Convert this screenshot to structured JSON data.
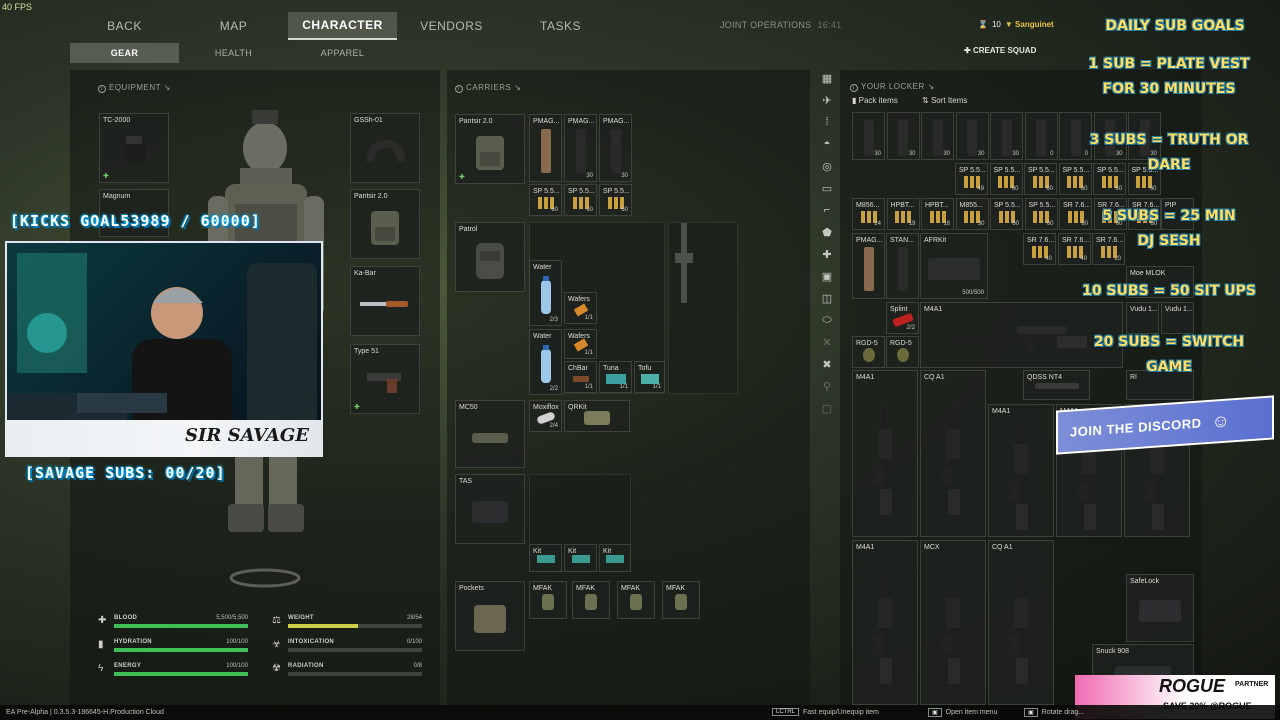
{
  "fps": "40 FPS",
  "nav": {
    "tabs": [
      {
        "label": "BACK"
      },
      {
        "label": "MAP"
      },
      {
        "label": "CHARACTER"
      },
      {
        "label": "VENDORS"
      },
      {
        "label": "TASKS"
      }
    ],
    "active": "CHARACTER",
    "joint_ops": "JOINT OPERATIONS",
    "time": "16:41"
  },
  "subnav": {
    "tabs": [
      {
        "label": "GEAR"
      },
      {
        "label": "HEALTH"
      },
      {
        "label": "APPAREL"
      }
    ]
  },
  "player": {
    "level": "10",
    "name": "Sanguinet",
    "create_squad": "CREATE SQUAD"
  },
  "equipment": {
    "title": "EQUIPMENT ↘",
    "slots": {
      "headset": "TC-2000",
      "magnum": "Magnum",
      "helmet": "GSSh-01",
      "vest": "Pantsir 2.0",
      "knife": "Ka-Bar",
      "pistol": "Type 51"
    }
  },
  "carriers": {
    "title": "CARRIERS ↘",
    "rig": {
      "name": "Pantsir 2.0",
      "items": [
        {
          "label": "PMAG..."
        },
        {
          "label": "PMAG...",
          "count": "30"
        },
        {
          "label": "PMAG...",
          "count": "30"
        },
        {
          "label": "SP 5.5...",
          "count": "60"
        },
        {
          "label": "SP 5.5...",
          "count": "60"
        },
        {
          "label": "SP 5.5...",
          "count": "60"
        }
      ]
    },
    "backpack": {
      "name": "Patrol",
      "items": [
        {
          "label": "Water",
          "count": "2/3"
        },
        {
          "label": "Wafers",
          "count": "1/1"
        },
        {
          "label": "Water",
          "count": "2/2"
        },
        {
          "label": "Wafers",
          "count": "1/1"
        },
        {
          "label": "ChBar",
          "count": "1/1"
        },
        {
          "label": "Tuna",
          "count": "1/1"
        },
        {
          "label": "Tofu",
          "count": "1/1"
        }
      ]
    },
    "belt": {
      "name": "MC50",
      "items": [
        {
          "label": "Moxiflox",
          "count": "2/4"
        },
        {
          "label": "QRKit"
        }
      ]
    },
    "case": {
      "name": "TAS",
      "items": [
        {
          "label": "Kit"
        },
        {
          "label": "Kit"
        },
        {
          "label": "Kit"
        }
      ]
    },
    "pockets": {
      "name": "Pockets",
      "items": [
        {
          "label": "MFAK"
        },
        {
          "label": "MFAK"
        },
        {
          "label": "MFAK"
        },
        {
          "label": "MFAK"
        }
      ]
    }
  },
  "stats": {
    "blood": {
      "label": "BLOOD",
      "value": "5,500/5,500",
      "fill": 1.0
    },
    "hydration": {
      "label": "HYDRATION",
      "value": "100/100",
      "fill": 1.0
    },
    "energy": {
      "label": "ENERGY",
      "value": "100/100",
      "fill": 1.0
    },
    "weight": {
      "label": "WEIGHT",
      "value": "28/54",
      "fill": 0.52
    },
    "intoxication": {
      "label": "INTOXICATION",
      "value": "0/100",
      "fill": 0
    },
    "radiation": {
      "label": "RADIATION",
      "value": "0/8",
      "fill": 0
    }
  },
  "locker": {
    "title": "YOUR LOCKER ↘",
    "pack_items": "Pack items",
    "sort_items": "Sort Items",
    "mag_row": [
      "30",
      "30",
      "30",
      "30",
      "30",
      "0",
      "0",
      "30",
      "30"
    ],
    "ammo_row1": [
      {
        "label": "SP 5.5...",
        "count": "49"
      },
      {
        "label": "SP 5.5...",
        "count": "60"
      },
      {
        "label": "SP 5.5...",
        "count": "60"
      },
      {
        "label": "SP 5.5...",
        "count": "60"
      },
      {
        "label": "SP 5.5...",
        "count": "60"
      },
      {
        "label": "SP 5.5...",
        "count": "60"
      }
    ],
    "ammo_row2": [
      {
        "label": "M856...",
        "count": "24"
      },
      {
        "label": "HPBT...",
        "count": "19"
      },
      {
        "label": "HPBT...",
        "count": "18"
      },
      {
        "label": "M855...",
        "count": "30"
      },
      {
        "label": "SP 5.5...",
        "count": "60"
      },
      {
        "label": "SP 5.5...",
        "count": "60"
      },
      {
        "label": "SR 7.6...",
        "count": "60"
      },
      {
        "label": "SR 7.6...",
        "count": "60"
      },
      {
        "label": "SR 7.6...",
        "count": "60"
      }
    ],
    "row3": [
      {
        "label": "PMAG..."
      },
      {
        "label": "STAN..."
      },
      {
        "label": "AFRKit",
        "count": "500/500"
      },
      {
        "label": "SR 7.6...",
        "count": "40"
      },
      {
        "label": "SR 7.6...",
        "count": "40"
      },
      {
        "label": "SR 7.6...",
        "count": "20"
      }
    ],
    "splint": {
      "label": "Splint",
      "count": "2/2"
    },
    "grenades": [
      {
        "label": "RGD-5"
      },
      {
        "label": "RGD-5"
      }
    ],
    "sniper": {
      "label": "M4A1"
    },
    "suppressor": {
      "label": "QDSS NT4"
    },
    "rifles_row1": [
      {
        "label": "M4A1"
      },
      {
        "label": "CQ A1"
      },
      {
        "label": "M4A1"
      },
      {
        "label": "M4A1"
      },
      {
        "label": "M4A1"
      }
    ],
    "rifles_row2": [
      {
        "label": "M4A1"
      },
      {
        "label": "MCX"
      },
      {
        "label": "CQ A1"
      }
    ],
    "safelock": {
      "label": "SafeLock"
    },
    "snuck": {
      "label": "Snuck 908"
    },
    "right_col": [
      {
        "label": "Moe MLOK"
      },
      {
        "label": "Vudu 1..."
      },
      {
        "label": "Vudu 1..."
      },
      {
        "label": "PIP"
      },
      {
        "label": "RI"
      }
    ]
  },
  "overlay": {
    "kicks_goal": "[KICKS GOAL53989 / 60000]",
    "savage_subs": "[SAVAGE SUBS: 00/20]",
    "cam_brand": "SIR SAVAGE",
    "goals": [
      "DAILY SUB GOALS",
      "1 SUB = PLATE VEST",
      "FOR 30 MINUTES",
      "3 SUBS = TRUTH OR",
      "DARE",
      "5 SUBS = 25 MIN",
      "DJ SESH",
      "10 SUBS = 50 SIT UPS",
      "20 SUBS = SWITCH",
      "GAME"
    ],
    "discord": "JOIN THE DISCORD",
    "rogue_top": "ROGUE",
    "rogue_sub": "PARTNER",
    "rogue_save": "SAVE 20% @ROGUE"
  },
  "bottom": {
    "version": "EA Pre-Alpha | 0.3.5.3-186645-H.Production Cloud",
    "hints": [
      {
        "key": "LCTRL",
        "text": "Fast equip/Unequip item"
      },
      {
        "key": "▣",
        "text": "Open item menu"
      },
      {
        "key": "▣",
        "text": "Rotate drag..."
      }
    ]
  }
}
